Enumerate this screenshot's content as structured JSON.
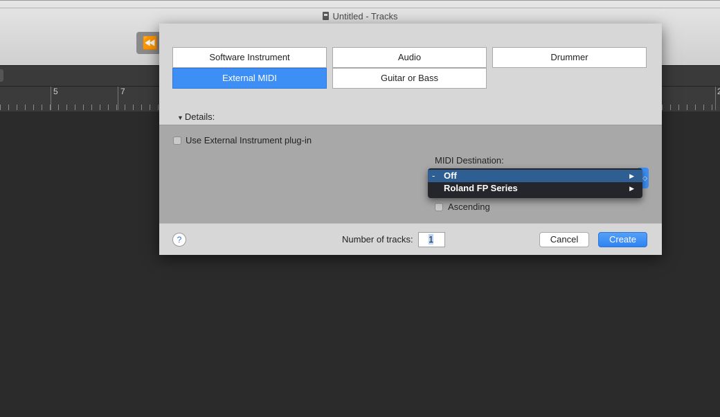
{
  "window": {
    "title": "Untitled - Tracks",
    "rewind_icon": "⏪"
  },
  "ruler": {
    "labels": [
      "5",
      "7",
      "2"
    ]
  },
  "dialog": {
    "track_types": [
      {
        "label": "Software Instrument",
        "selected": false
      },
      {
        "label": "Audio",
        "selected": false
      },
      {
        "label": "Drummer",
        "selected": false
      },
      {
        "label": "External MIDI",
        "selected": true
      },
      {
        "label": "Guitar or Bass",
        "selected": false
      }
    ],
    "details": {
      "toggle_label": "Details:",
      "toggle_icon": "▼",
      "use_external_plugin_label": "Use External Instrument plug-in",
      "use_external_plugin_checked": false,
      "midi_destination_label": "MIDI Destination:",
      "midi_menu": {
        "items": [
          {
            "label": "Off",
            "mark": "-",
            "highlighted": true,
            "submenu_icon": "▶"
          },
          {
            "label": "Roland FP Series",
            "mark": "",
            "highlighted": false,
            "submenu_icon": "▶"
          }
        ]
      },
      "ascending_label": "Ascending",
      "ascending_checked": false
    },
    "footer": {
      "help_label": "?",
      "num_tracks_label": "Number of tracks:",
      "num_tracks_value": "1",
      "cancel_label": "Cancel",
      "create_label": "Create"
    }
  },
  "colors": {
    "accent": "#3d8ff5",
    "menu_bg": "#24262b",
    "menu_highlight": "#2f5f92"
  }
}
